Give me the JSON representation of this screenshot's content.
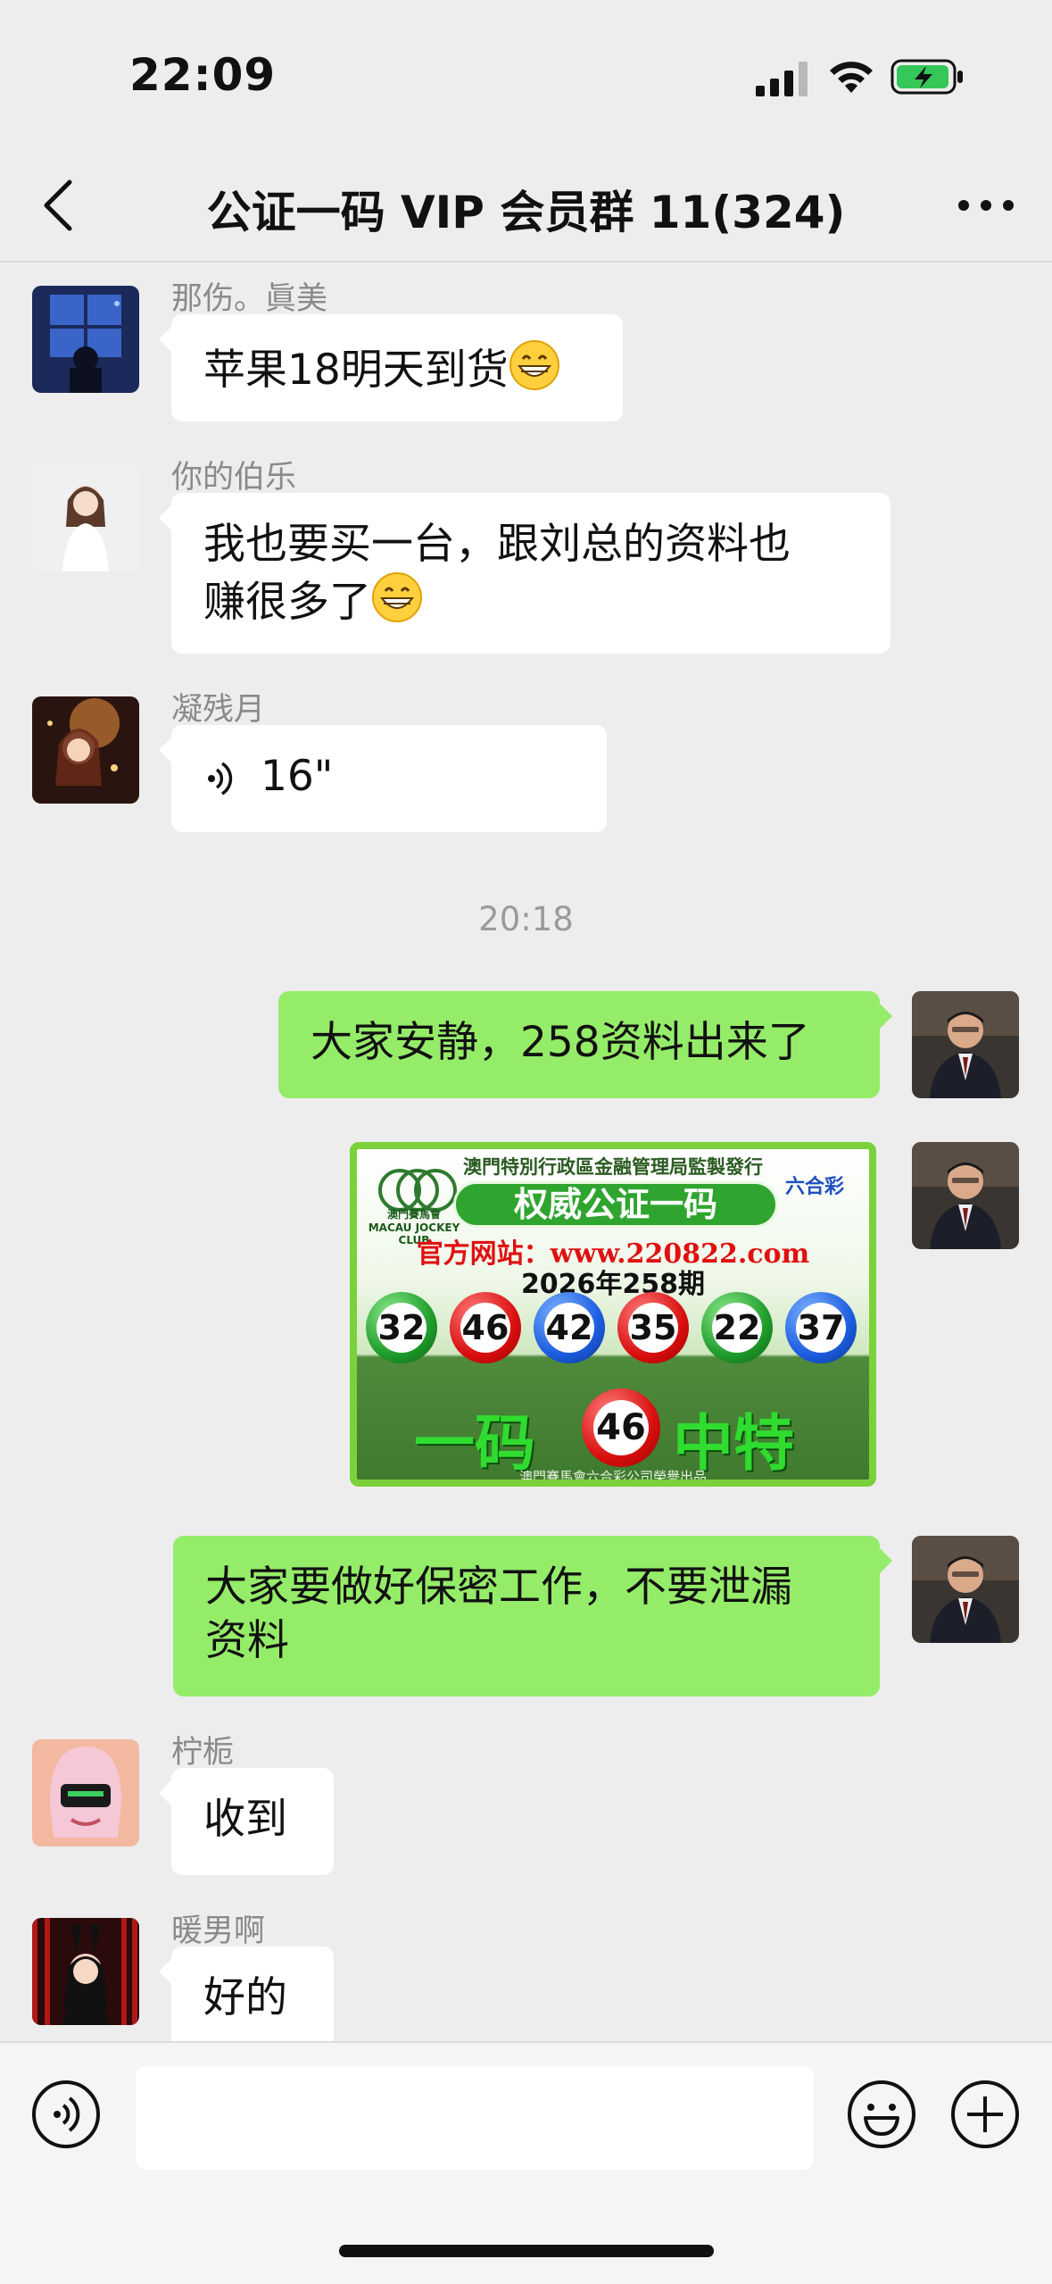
{
  "status_bar": {
    "time": "22:09"
  },
  "header": {
    "title": "公证一码 VIP 会员群 11(324)"
  },
  "messages": [
    {
      "sender": "那伤。眞美",
      "text": "苹果18明天到货",
      "emoji": "grin"
    },
    {
      "sender": "你的伯乐",
      "line1": "我也要买一台，跟刘总的资料也",
      "line2": "赚很多了",
      "emoji": "grin"
    },
    {
      "sender": "凝残月",
      "voice_duration": "16\""
    },
    {
      "time": "20:18"
    },
    {
      "sender": "me",
      "text": "大家安静，258资料出来了"
    },
    {
      "sender": "me",
      "image": {
        "top_text": "澳門特別行政區金融管理局監製發行",
        "logo_left_line1": "澳門賽馬會",
        "logo_left_line2": "MACAU JOCKEY CLUB",
        "logo_right": "六合彩",
        "badge": "权威公证一码",
        "site": "官方网站：www.220822.com",
        "issue": "2026年258期",
        "balls": [
          {
            "number": "32",
            "color": "green"
          },
          {
            "number": "46",
            "color": "red"
          },
          {
            "number": "42",
            "color": "blue"
          },
          {
            "number": "35",
            "color": "red"
          },
          {
            "number": "22",
            "color": "green"
          },
          {
            "number": "37",
            "color": "blue"
          }
        ],
        "bottom_left": "一码",
        "bottom_number": "46",
        "bottom_right": "中特",
        "footer": "澳門賽馬會六合彩公司榮譽出品"
      }
    },
    {
      "sender": "me",
      "line1": "大家要做好保密工作，不要泄漏",
      "line2": "资料"
    },
    {
      "sender": "柠栀",
      "text": "收到"
    },
    {
      "sender": "暖男啊",
      "text": "好的"
    }
  ],
  "input_bar": {
    "value": "",
    "icons": [
      "voice-icon",
      "emoji-icon",
      "plus-icon"
    ]
  },
  "colors": {
    "my_bubble": "#95ec69",
    "other_bubble": "#ffffff",
    "background": "#ededed"
  }
}
